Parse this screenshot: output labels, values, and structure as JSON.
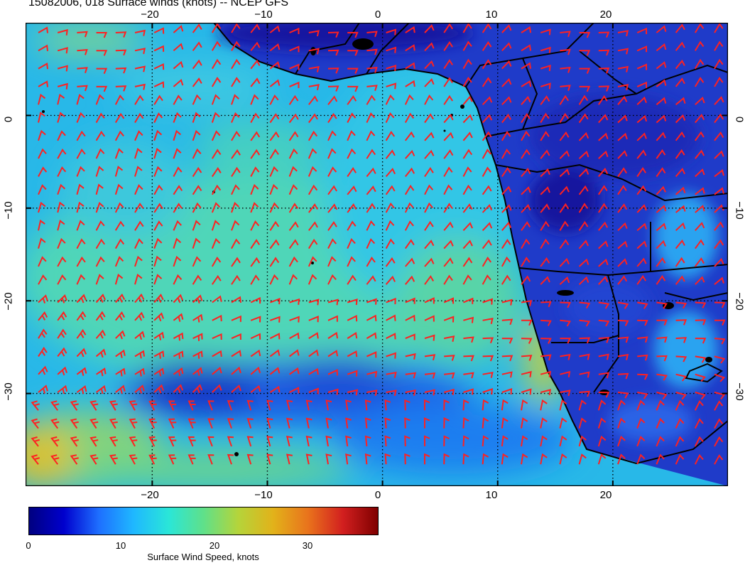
{
  "title": "15082006, 018 Surface winds (knots) -- NCEP GFS",
  "map": {
    "lon_range": [
      -31,
      30
    ],
    "lat_range": [
      -40,
      10
    ],
    "top_ticks": [
      "−20",
      "−10",
      "0",
      "10",
      "20"
    ],
    "bottom_ticks": [
      "−20",
      "−10",
      "0",
      "10",
      "20"
    ],
    "left_ticks": [
      "0",
      "−10",
      "−20",
      "−30"
    ],
    "right_ticks": [
      "0",
      "−10",
      "−20",
      "−30"
    ],
    "grid_style": "dotted",
    "barb_color": "#ff2020",
    "land_outline_color": "#000000"
  },
  "colorbar": {
    "title": "Surface Wind Speed, knots",
    "labels": [
      "0",
      "10",
      "20",
      "30"
    ],
    "range": [
      0,
      38
    ],
    "colors": [
      "#000080",
      "#0000cd",
      "#1e6fff",
      "#1fb8ff",
      "#2ae6d8",
      "#5fe08a",
      "#b5d43a",
      "#e2b21a",
      "#e9731c",
      "#d21f1f",
      "#7f0000"
    ]
  }
}
